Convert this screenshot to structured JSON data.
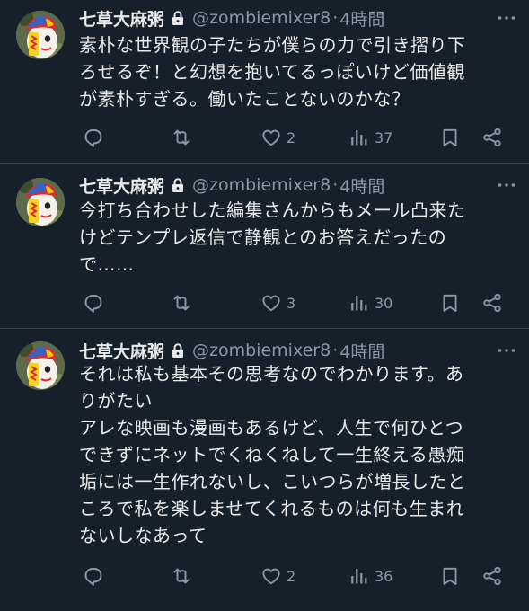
{
  "tweets": [
    {
      "name": "七草大麻粥",
      "handle": "@zombiemixer8",
      "separator": "·",
      "time": "4時間",
      "text": "素朴な世界観の子たちが僕らの力で引き摺り下\nろせるぞ！と幻想を抱いてるっぽいけど価値観\nが素朴すぎる。働いたことないのかな？",
      "likes": "2",
      "views": "37",
      "icons": [
        "lock-icon",
        "more-icon",
        "reply-icon",
        "retweet-icon",
        "like-icon",
        "views-icon",
        "bookmark-icon",
        "share-icon"
      ]
    },
    {
      "name": "七草大麻粥",
      "handle": "@zombiemixer8",
      "separator": "·",
      "time": "4時間",
      "text": "今打ち合わせした編集さんからもメール凸来た\nけどテンプレ返信で静観とのお答えだったの\nで……",
      "likes": "3",
      "views": "30",
      "icons": [
        "lock-icon",
        "more-icon",
        "reply-icon",
        "retweet-icon",
        "like-icon",
        "views-icon",
        "bookmark-icon",
        "share-icon"
      ]
    },
    {
      "name": "七草大麻粥",
      "handle": "@zombiemixer8",
      "separator": "·",
      "time": "4時間",
      "text": "それは私も基本その思考なのでわかります。あ\nりがたい\nアレな映画も漫画もあるけど、人生で何ひとつ\nできずにネットでくねくねして一生終える愚痴\n垢には一生作れないし、こいつらが増長したと\nころで私を楽しませてくれるものは何も生まれ\nないしなあって",
      "likes": "2",
      "views": "36",
      "icons": [
        "lock-icon",
        "more-icon",
        "reply-icon",
        "retweet-icon",
        "like-icon",
        "views-icon",
        "bookmark-icon",
        "share-icon"
      ]
    }
  ],
  "colors": {
    "background": "#15202b",
    "text": "#e7e9ea",
    "muted": "#8b98a5",
    "divider": "#38444d"
  }
}
